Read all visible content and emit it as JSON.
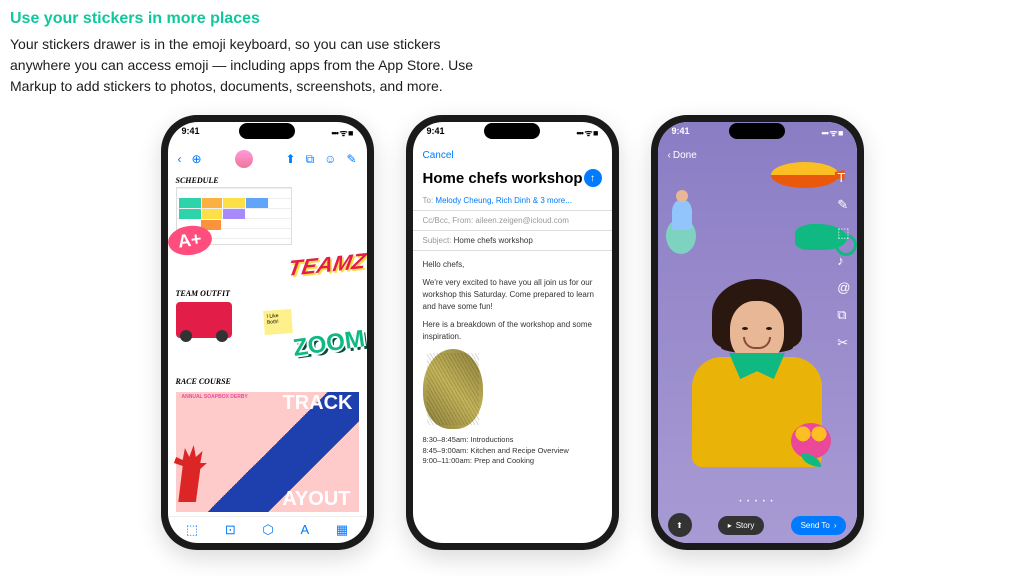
{
  "header": {
    "title": "Use your stickers in more places",
    "description": "Your stickers drawer is in the emoji keyboard, so you can use stickers anywhere you can access emoji — including apps from the App Store. Use Markup to add stickers to photos, documents, screenshots, and more."
  },
  "status": {
    "time": "9:41",
    "indicators": "••• ᯤ ■"
  },
  "phone1": {
    "labels": {
      "schedule": "SCHEDULE",
      "outfit": "TEAM OUTFIT",
      "race": "RACE COURSE"
    },
    "stickers": {
      "aplus": "A+",
      "teamz": "TEAMZ",
      "zoom": "ZOOM",
      "note": "I Like Both!"
    },
    "poster": {
      "derby": "ANNUAL SOAPBOX DERBY",
      "track": "TRACK",
      "layout": "AYOUT"
    },
    "toolbar_top": [
      "‹",
      "⊕",
      "👤",
      "⬆",
      "⧉",
      "☺",
      "✎"
    ],
    "toolbar_bottom": [
      "⬚",
      "⊡",
      "⬡",
      "A",
      "▦"
    ]
  },
  "phone2": {
    "cancel": "Cancel",
    "subject_title": "Home chefs workshop",
    "fields": {
      "to_label": "To:",
      "to_value": "Melody Cheung, Rich Dinh & 3 more...",
      "cc_label": "Cc/Bcc, From:",
      "cc_value": "aileen.zeigen@icloud.com",
      "subject_label": "Subject:",
      "subject_value": "Home chefs workshop"
    },
    "body": {
      "greeting": "Hello chefs,",
      "p1": "We're very excited to have you all join us for our workshop this Saturday. Come prepared to learn and have some fun!",
      "p2": "Here is a breakdown of the workshop and some inspiration.",
      "schedule": [
        "8:30–8:45am: Introductions",
        "8:45–9:00am: Kitchen and Recipe Overview",
        "9:00–11:00am: Prep and Cooking"
      ]
    }
  },
  "phone3": {
    "done": "Done",
    "tools": [
      "T",
      "✎",
      "⬚",
      "♪",
      "@",
      "⧉",
      "✂"
    ],
    "bottom": {
      "story": "Story",
      "send": "Send To",
      "share": "⬆"
    }
  }
}
